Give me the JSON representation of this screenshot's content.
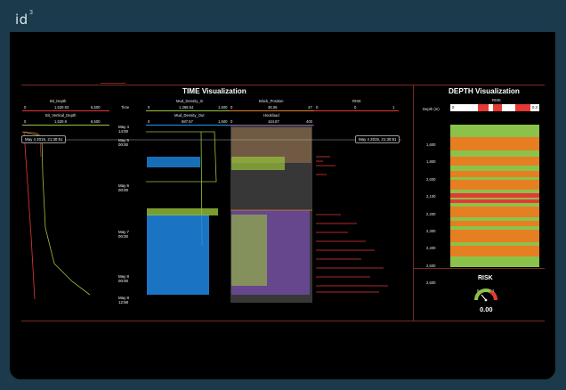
{
  "app": {
    "logo": "id",
    "logo_sup": "3"
  },
  "time_panel": {
    "title": "TIME Visualization",
    "tracks": {
      "bit_depth": {
        "label": "Bit_Depth",
        "min": "0",
        "value": "1,530.93",
        "max": "6,500"
      },
      "bit_vertical_depth": {
        "label": "Bit_Vertical_Depth",
        "min": "0",
        "value": "1,530.9",
        "max": "6,500"
      },
      "time_label": "Time",
      "mud_density_in": {
        "label": "Mud_Density_In",
        "min": "0",
        "value": "1,368.54",
        "max": "1,500"
      },
      "mud_density_out": {
        "label": "Mud_Density_Out",
        "min": "0",
        "value": "687.57",
        "max": "1,500"
      },
      "block_position": {
        "label": "Block_Position",
        "min": "0",
        "value": "36.06",
        "max": "47"
      },
      "hookload": {
        "label": "Hookload",
        "min": "0",
        "value": "164.87",
        "max": "400"
      },
      "risk": {
        "label": "RISK",
        "min": "0",
        "value": "0",
        "max": "1"
      }
    },
    "time_ticks": [
      {
        "date": "May 4",
        "time": "14:00"
      },
      {
        "date": "May 5",
        "time": "00:00"
      },
      {
        "date": "May 6",
        "time": "00:00"
      },
      {
        "date": "May 7",
        "time": "00:00"
      },
      {
        "date": "May 8",
        "time": "00:00"
      },
      {
        "date": "May 8",
        "time": "12:58"
      }
    ],
    "tooltip_left": "May 4 2015, 21:30:51",
    "tooltip_right": "May 4 2015, 21:30:51"
  },
  "depth_panel": {
    "title": "DEPTH Visualization",
    "risk_label": "RISK",
    "depth_axis_label": "Depth (m)",
    "risk_min": "0",
    "risk_max": "0.3",
    "depth_ticks": [
      "1,600",
      "1,800",
      "2,000",
      "2,100",
      "2,200",
      "2,300",
      "2,400",
      "2,500",
      "2,600"
    ]
  },
  "risk_widget": {
    "title": "RISK",
    "gauge_min": "0",
    "gauge_max": "1",
    "value": "0.00"
  },
  "colors": {
    "frame": "#1b3a4b",
    "accent_red": "#e53935",
    "green": "#8bc34a",
    "orange": "#e67e22",
    "blue": "#2196f3",
    "purple": "#7b4fb3"
  }
}
